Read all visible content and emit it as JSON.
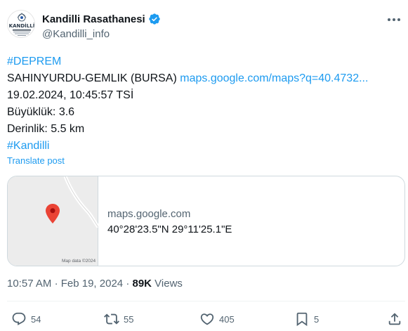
{
  "author": {
    "display_name": "Kandilli Rasathanesi",
    "handle": "@Kandilli_info",
    "avatar_text": "KANDİLLİ"
  },
  "tweet": {
    "hashtag_1": "#DEPREM",
    "location": "SAHINYURDU-GEMLIK (BURSA) ",
    "map_link": "maps.google.com/maps?q=40.4732...",
    "datetime_line": "19.02.2024, 10:45:57 TSİ",
    "magnitude_line": "Büyüklük: 3.6",
    "depth_line": "Derinlik: 5.5 km",
    "hashtag_2": "#Kandilli",
    "translate_label": "Translate post"
  },
  "card": {
    "domain": "maps.google.com",
    "coordinates": "40°28'23.5\"N 29°11'25.1\"E",
    "map_credit": "Map data ©2024"
  },
  "meta": {
    "time": "10:57 AM",
    "separator": "·",
    "date": "Feb 19, 2024",
    "views_count": "89K",
    "views_label": " Views"
  },
  "actions": {
    "replies": "54",
    "reposts": "55",
    "likes": "405",
    "bookmarks": "5"
  },
  "colors": {
    "accent": "#1d9bf0",
    "text_primary": "#0f1419",
    "text_secondary": "#536471",
    "border": "#cfd9de",
    "pin": "#ea4335"
  }
}
